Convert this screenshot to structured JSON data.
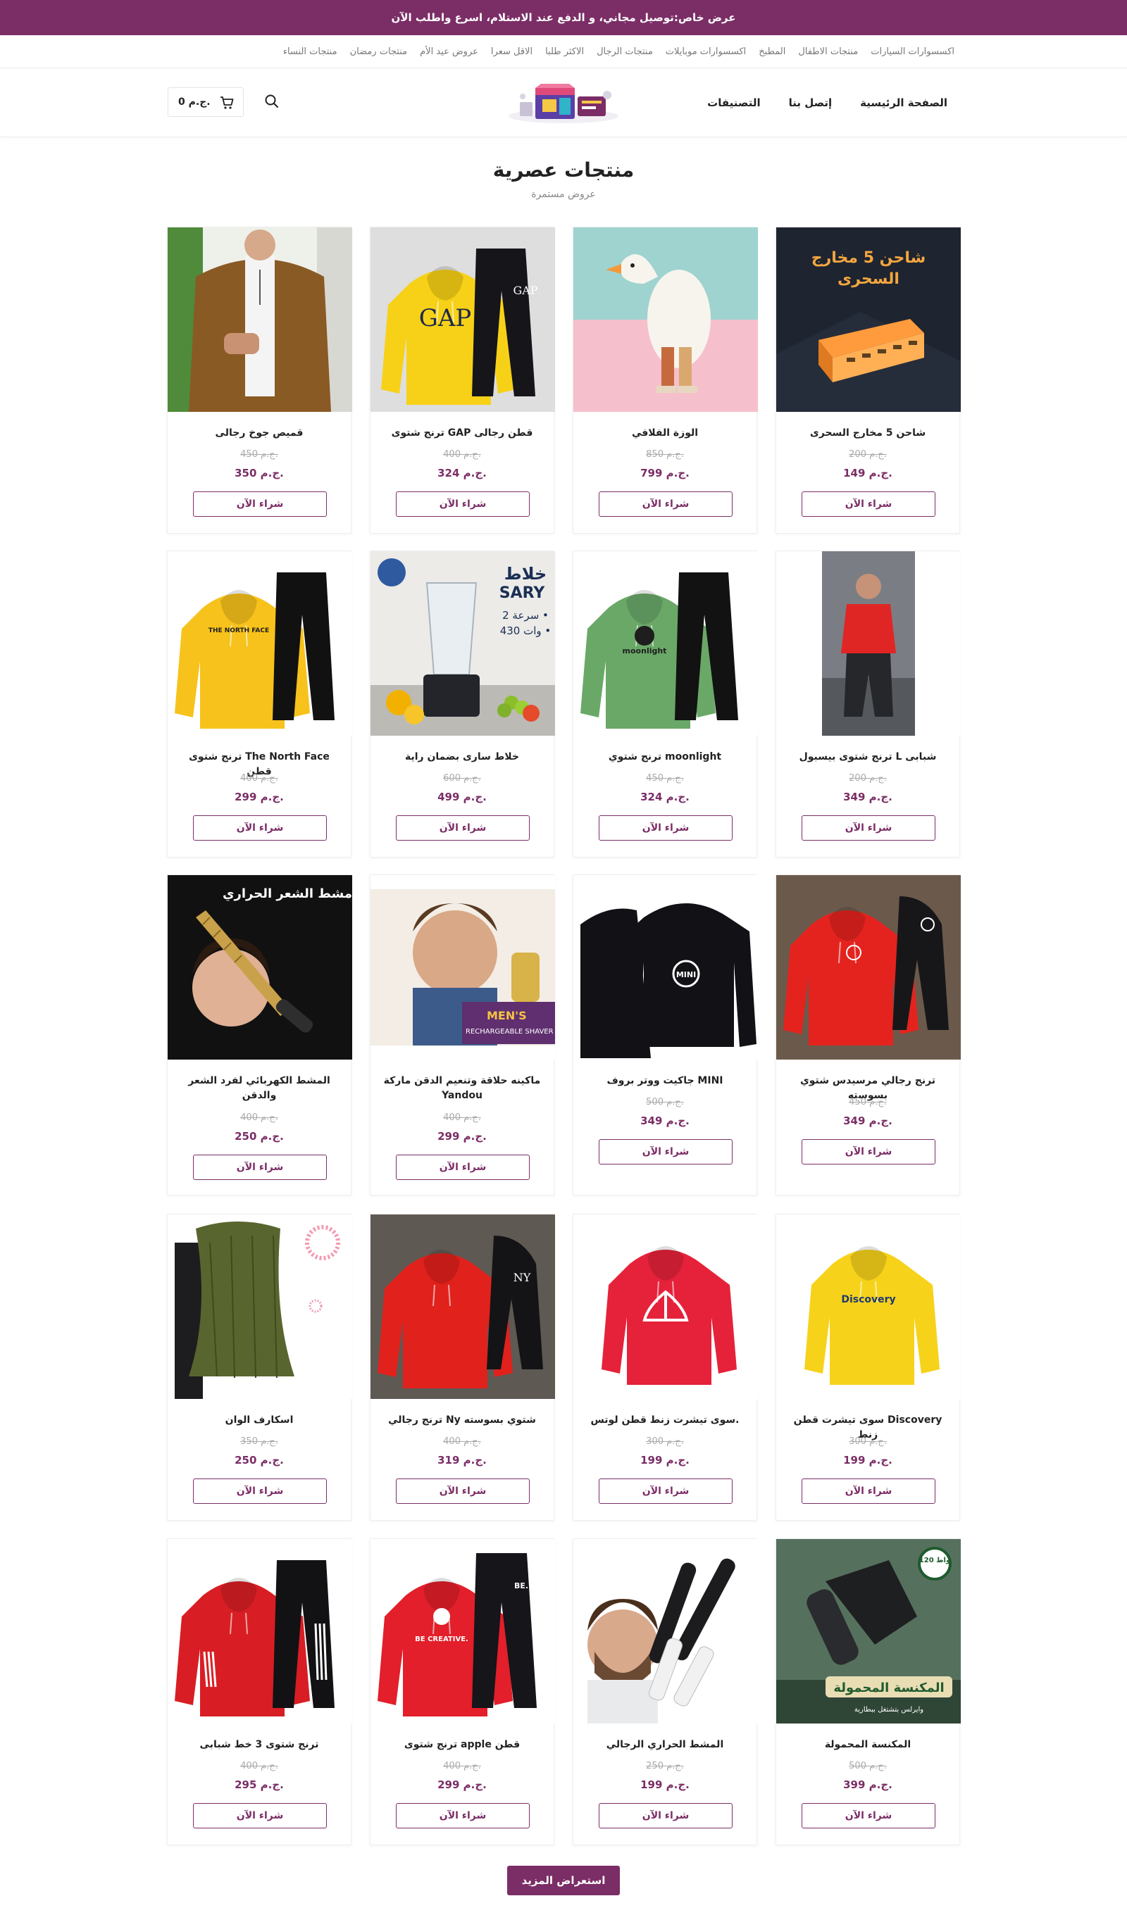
{
  "promo": {
    "text": "عرض خاص:توصيل مجاني، و الدفع عند الاستلام، اسرع واطلب الآن"
  },
  "category_nav": [
    "اكسسوارات السيارات",
    "منتجات الاطفال",
    "المطبخ",
    "اكسسوارات موبايلات",
    "منتجات الرجال",
    "الاكثر طلبا",
    "الاقل سعرا",
    "عروض عيد الأم",
    "منتجات رمضان",
    "منتجات النساء"
  ],
  "main_nav": [
    "الصفحة الرئيسية",
    "إتصل بنا",
    "التصنيفات"
  ],
  "cart": {
    "total": "0 ج.م."
  },
  "section": {
    "title": "منتجات عصرية",
    "subtitle": "عروض مستمرة"
  },
  "buy_label": "شراء الآن",
  "load_more": "استعراض المزيد",
  "products": [
    {
      "name": "شاحن 5 مخارج السحرى",
      "old_price": "200 ج.م.",
      "price": "149 ج.م.",
      "image": "charger",
      "image_text": [
        "شاحن 5 مخارج",
        "السحرى"
      ]
    },
    {
      "name": "الوزة الفلافي",
      "old_price": "850 ج.م.",
      "price": "799 ج.م.",
      "image": "goose",
      "image_text": []
    },
    {
      "name": "ترنج شتوى GAP قطن رجالى",
      "old_price": "400 ج.م.",
      "price": "324 ج.م.",
      "image": "gap-tracksuit",
      "image_text": [
        "GAP",
        "GAP"
      ]
    },
    {
      "name": "قميص جوخ رجالى",
      "old_price": "450 ج.م.",
      "price": "350 ج.م.",
      "image": "shirt",
      "image_text": []
    },
    {
      "name": "ترنج شتوى بيسبول L شبابى",
      "old_price": "200 ج.م.",
      "price": "349 ج.م.",
      "image": "baseball-tracksuit",
      "image_text": []
    },
    {
      "name": "ترنج شتوي moonlight",
      "old_price": "450 ج.م.",
      "price": "324 ج.م.",
      "image": "moonlight-tracksuit",
      "image_text": [
        "moonlight"
      ]
    },
    {
      "name": "خلاط سارى بضمان راية",
      "old_price": "600 ج.م.",
      "price": "499 ج.م.",
      "image": "blender",
      "image_text": [
        "خلاط",
        "SARY",
        "2 سرعة •",
        "430 وات •"
      ]
    },
    {
      "name": "ترنج شتوى The North Face قطن",
      "old_price": "400 ج.م.",
      "price": "299 ج.م.",
      "image": "northface-tracksuit",
      "image_text": [
        "THE NORTH FACE"
      ]
    },
    {
      "name": "ترنج رجالي مرسيدس شتوي بسوسته",
      "old_price": "450 ج.م.",
      "price": "349 ج.م.",
      "image": "mercedes-tracksuit",
      "image_text": []
    },
    {
      "name": "جاكيت ووتر بروف MINI",
      "old_price": "500 ج.م.",
      "price": "349 ج.م.",
      "image": "mini-jacket",
      "image_text": [
        "MINI"
      ]
    },
    {
      "name": "ماكينه حلاقة وتنعيم الدقن ماركة Yandou",
      "old_price": "400 ج.م.",
      "price": "299 ج.م.",
      "image": "shaver",
      "image_text": [
        "MEN'S",
        "RECHARGEABLE SHAVER"
      ]
    },
    {
      "name": "المشط الكهربائي لفرد الشعر والدقن",
      "old_price": "400 ج.م.",
      "price": "250 ج.م.",
      "image": "hot-comb",
      "image_text": [
        "مشط الشعر الحراري"
      ]
    },
    {
      "name": "سوى تيشرت قطن Discovery زنط",
      "old_price": "300 ج.م.",
      "price": "199 ج.م.",
      "image": "discovery-hoodie",
      "image_text": [
        "Discovery"
      ]
    },
    {
      "name": "سوى تيشرت زنط قطن لوتس.",
      "old_price": "300 ج.م.",
      "price": "199 ج.م.",
      "image": "lotus-hoodie",
      "image_text": []
    },
    {
      "name": "ترنج رجالي Ny شتوي بسوسته",
      "old_price": "400 ج.م.",
      "price": "319 ج.م.",
      "image": "ny-tracksuit",
      "image_text": [
        "NY"
      ]
    },
    {
      "name": "اسكارف الوان",
      "old_price": "350 ج.م.",
      "price": "250 ج.م.",
      "image": "scarf",
      "image_text": []
    },
    {
      "name": "المكنسة المحمولة",
      "old_price": "500 ج.م.",
      "price": "399 ج.م.",
      "image": "vacuum",
      "image_text": [
        "120 واط",
        "المكنسة المحمولة",
        "وايرلس بتشتغل ببطارية"
      ]
    },
    {
      "name": "المشط الحراري الرجالي",
      "old_price": "250 ج.م.",
      "price": "199 ج.م.",
      "image": "beard-comb",
      "image_text": []
    },
    {
      "name": "ترنج شتوى apple قطن",
      "old_price": "400 ج.م.",
      "price": "299 ج.م.",
      "image": "apple-tracksuit",
      "image_text": [
        "BE CREATIVE.",
        "BE."
      ]
    },
    {
      "name": "ترنج شتوى 3 خط شبابى",
      "old_price": "400 ج.م.",
      "price": "295 ج.م.",
      "image": "stripes-tracksuit",
      "image_text": []
    }
  ]
}
